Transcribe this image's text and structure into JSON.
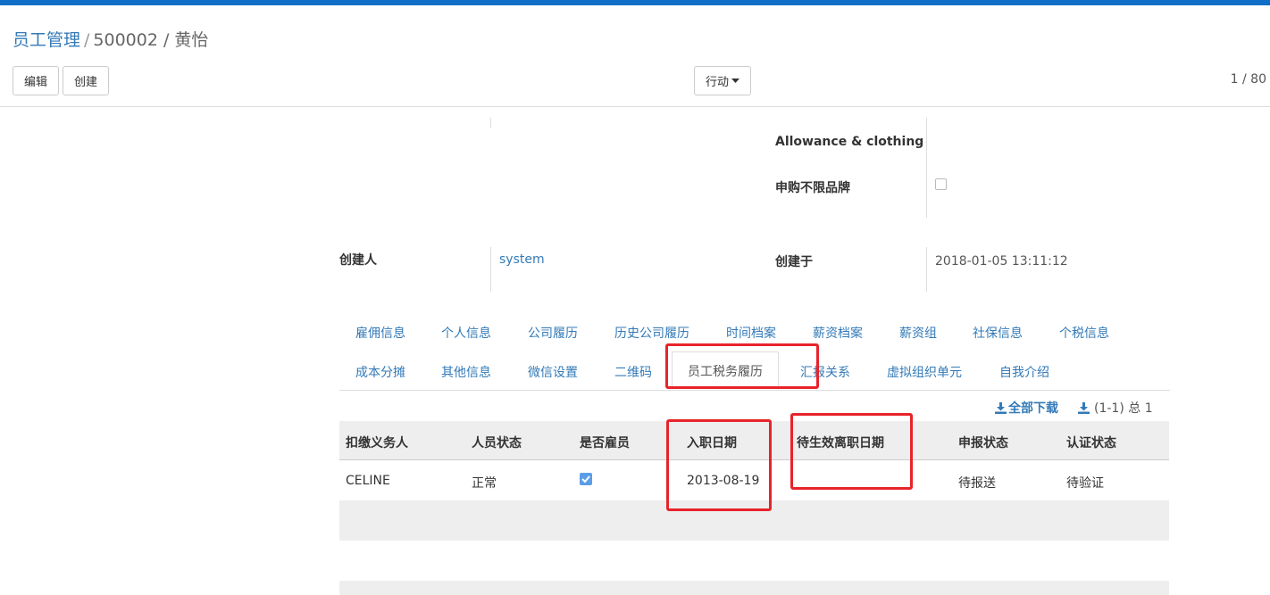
{
  "breadcrumb": {
    "root": "员工管理",
    "sep": "/",
    "current": "500002 / 黄怡"
  },
  "toolbar": {
    "edit_label": "编辑",
    "create_label": "创建",
    "action_label": "行动"
  },
  "pager": {
    "text": "1 / 80"
  },
  "form": {
    "allowance_label": "Allowance & clothing",
    "purchase_label": "申购不限品牌",
    "purchase_checked": false,
    "creator_label": "创建人",
    "creator_value": "system",
    "created_label": "创建于",
    "created_value": "2018-01-05 13:11:12"
  },
  "tabs_row1": [
    "雇佣信息",
    "个人信息",
    "公司履历",
    "历史公司履历",
    "时间档案",
    "薪资档案",
    "薪资组",
    "社保信息",
    "个税信息"
  ],
  "tabs_row2": [
    "成本分摊",
    "其他信息",
    "微信设置",
    "二维码",
    "员工税务履历",
    "汇报关系",
    "虚拟组织单元",
    "自我介绍"
  ],
  "active_tab": "员工税务履历",
  "list_controls": {
    "download_all": "全部下载",
    "record_range": "(1-1) 总 1"
  },
  "table": {
    "headers": [
      "扣缴义务人",
      "人员状态",
      "是否雇员",
      "入职日期",
      "待生效离职日期",
      "申报状态",
      "认证状态"
    ],
    "rows": [
      {
        "withholder": "CELINE",
        "status": "正常",
        "is_employee": true,
        "hire_date": "2013-08-19",
        "leave_date": "",
        "report_status": "待报送",
        "verify_status": "待验证"
      }
    ]
  },
  "colors": {
    "accent": "#0f6fc6",
    "link": "#337ab7",
    "highlight": "#e8232a",
    "checkbox": "#5b9ee8"
  }
}
